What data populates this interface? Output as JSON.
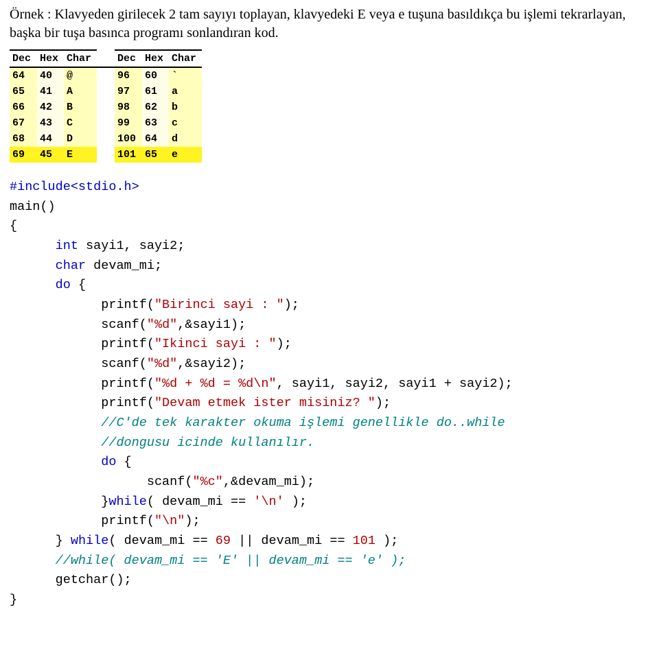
{
  "intro": "Örnek : Klavyeden girilecek 2 tam sayıyı toplayan, klavyedeki E veya e tuşuna basıldıkça bu işlemi tekrarlayan, başka bir tuşa basınca programı sonlandıran kod.",
  "ascii": {
    "headers": [
      "Dec",
      "Hex",
      "Char",
      "Dec",
      "Hex",
      "Char"
    ],
    "rows": [
      {
        "d1": "64",
        "h1": "40",
        "c1": "@",
        "d2": "96",
        "h2": "60",
        "c2": "`",
        "hl": false
      },
      {
        "d1": "65",
        "h1": "41",
        "c1": "A",
        "d2": "97",
        "h2": "61",
        "c2": "a",
        "hl": false
      },
      {
        "d1": "66",
        "h1": "42",
        "c1": "B",
        "d2": "98",
        "h2": "62",
        "c2": "b",
        "hl": false
      },
      {
        "d1": "67",
        "h1": "43",
        "c1": "C",
        "d2": "99",
        "h2": "63",
        "c2": "c",
        "hl": false
      },
      {
        "d1": "68",
        "h1": "44",
        "c1": "D",
        "d2": "100",
        "h2": "64",
        "c2": "d",
        "hl": false
      },
      {
        "d1": "69",
        "h1": "45",
        "c1": "E",
        "d2": "101",
        "h2": "65",
        "c2": "e",
        "hl": true
      }
    ]
  },
  "code": {
    "include": "#include<stdio.h>",
    "mainfn": "main()",
    "obrace": "{",
    "t_int": "int",
    "decl1": " sayi1, sayi2;",
    "t_char": "char",
    "decl2": " devam_mi;",
    "do_kw": "do",
    "do_open": " {",
    "p1a": "printf(",
    "s1": "\"Birinci sayi : \"",
    "p1b": ");",
    "p2a": "scanf(",
    "s2": "\"%d\"",
    "p2b": ",&sayi1);",
    "p3s": "\"Ikinci sayi : \"",
    "p4b": ",&sayi2);",
    "p5s": "\"%d + %d = %d\\n\"",
    "p5b": ", sayi1, sayi2, sayi1 + sayi2);",
    "p6s": "\"Devam etmek ister misiniz? \"",
    "cmt1": "//C'de tek karakter okuma işlemi genellikle do..while",
    "cmt2": "//dongusu icinde kullanılır.",
    "s7": "\"%c\"",
    "p7b": ",&devam_mi);",
    "while_kw": "while",
    "w1a": "}",
    "w1b": "( devam_mi == ",
    "chr_nl": "'\\n'",
    "w1c": " );",
    "p8s": "\"\\n\"",
    "close_do": "} ",
    "w2a": "( devam_mi == ",
    "n69": "69",
    "w2b": " || devam_mi == ",
    "n101": "101",
    "w2c": " );",
    "cmt3": "//while( devam_mi == 'E' || devam_mi == 'e' );",
    "getch": "getchar();",
    "cbrace": "}"
  }
}
